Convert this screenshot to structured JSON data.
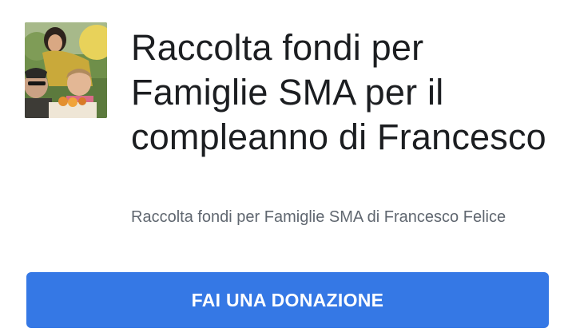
{
  "fundraiser": {
    "title": "Raccolta fondi per Famiglie SMA per il compleanno di Francesco",
    "subtitle": "Raccolta fondi per Famiglie SMA di Francesco Felice",
    "donate_label": "FAI UNA DONAZIONE",
    "photo_icon": "family-photo"
  },
  "colors": {
    "button_bg": "#3578e5",
    "button_text": "#ffffff",
    "title_text": "#1c1e21",
    "subtitle_text": "#606770"
  }
}
